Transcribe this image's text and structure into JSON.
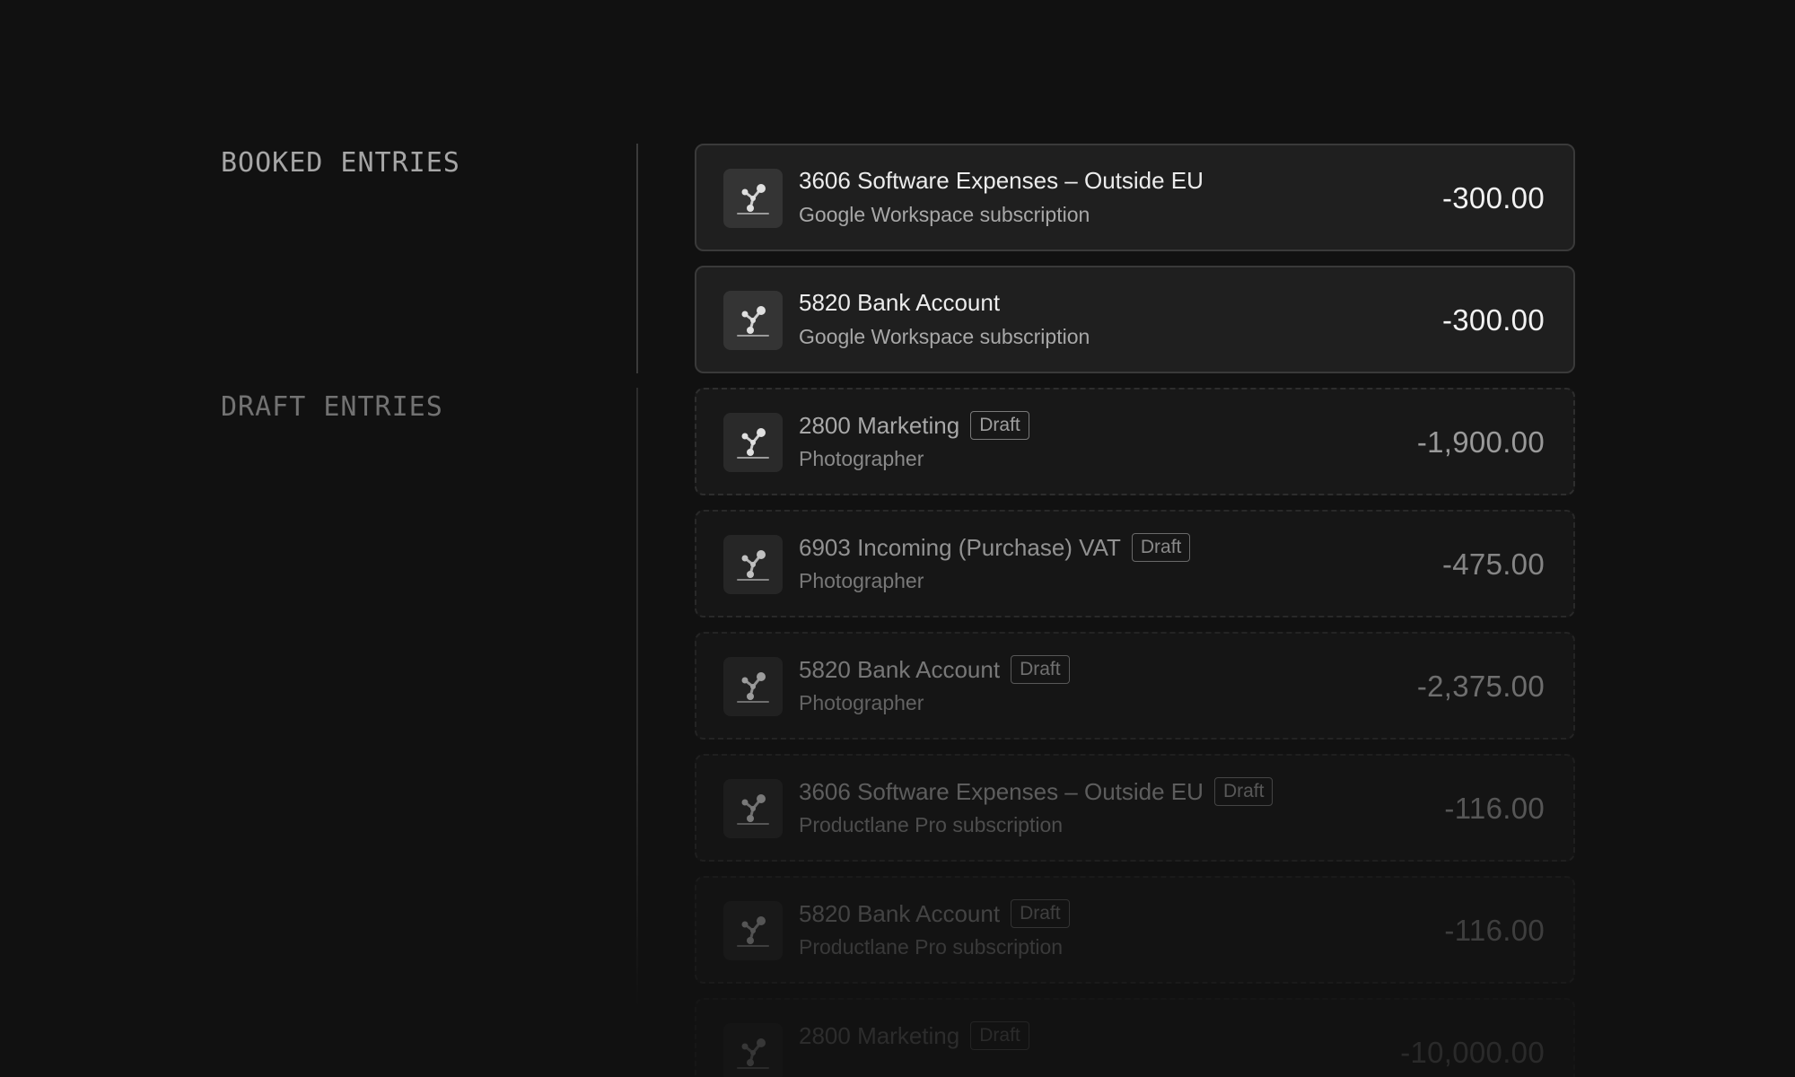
{
  "sections": {
    "booked_label": "BOOKED ENTRIES",
    "draft_label": "DRAFT ENTRIES"
  },
  "logo_icon": "e-conomic-logo-icon",
  "colors": {
    "background": "#111111",
    "card_booked": "#1f1f1f",
    "card_draft": "#181818"
  },
  "booked_entries": [
    {
      "account": "3606 Software Expenses – Outside EU",
      "description": "Google Workspace subscription",
      "amount": "-300.00"
    },
    {
      "account": "5820 Bank Account",
      "description": "Google Workspace subscription",
      "amount": "-300.00"
    }
  ],
  "draft_entries": [
    {
      "account": "2800 Marketing",
      "badge": "Draft",
      "description": "Photographer",
      "amount": "-1,900.00",
      "opacity": 1.0
    },
    {
      "account": "6903 Incoming (Purchase) VAT",
      "badge": "Draft",
      "description": "Photographer",
      "amount": "-475.00",
      "opacity": 0.85
    },
    {
      "account": "5820 Bank Account",
      "badge": "Draft",
      "description": "Photographer",
      "amount": "-2,375.00",
      "opacity": 0.68
    },
    {
      "account": "3606 Software Expenses – Outside EU",
      "badge": "Draft",
      "description": "Productlane Pro subscription",
      "amount": "-116.00",
      "opacity": 0.5
    },
    {
      "account": "5820 Bank Account",
      "badge": "Draft",
      "description": "Productlane Pro subscription",
      "amount": "-116.00",
      "opacity": 0.33
    },
    {
      "account": "2800 Marketing",
      "badge": "Draft",
      "description": "",
      "amount": "-10,000.00",
      "opacity": 0.18
    }
  ]
}
